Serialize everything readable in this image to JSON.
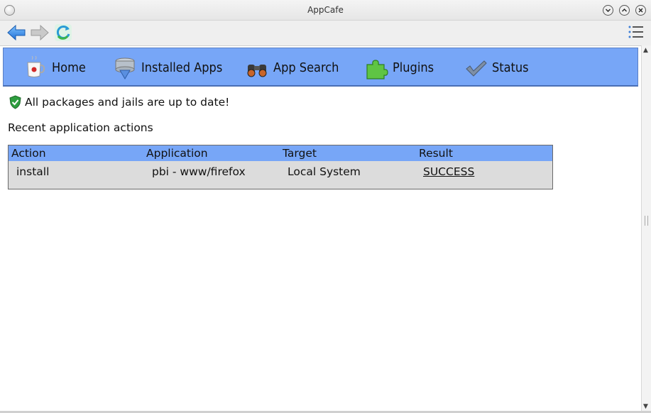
{
  "window": {
    "title": "AppCafe"
  },
  "nav": {
    "items": [
      {
        "label": "Home",
        "icon": "coffee-cup-icon"
      },
      {
        "label": "Installed Apps",
        "icon": "installed-apps-icon"
      },
      {
        "label": "App Search",
        "icon": "binoculars-icon"
      },
      {
        "label": "Plugins",
        "icon": "puzzle-piece-icon"
      },
      {
        "label": "Status",
        "icon": "checkmark-icon"
      }
    ]
  },
  "status": {
    "message": "All packages and jails are up to date!",
    "icon": "shield-check-icon"
  },
  "recent": {
    "heading": "Recent application actions",
    "columns": [
      "Action",
      "Application",
      "Target",
      "Result"
    ],
    "rows": [
      {
        "action": "install",
        "application": "pbi - www/firefox",
        "target": "Local System",
        "result": "SUCCESS"
      }
    ]
  },
  "colors": {
    "accent": "#77a6f7",
    "table_body": "#dcdcdc",
    "success_icon": "#2e9e3f"
  }
}
